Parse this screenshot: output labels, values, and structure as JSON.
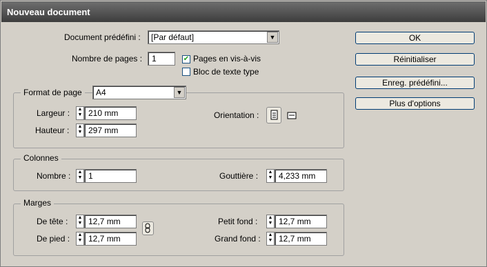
{
  "title": "Nouveau document",
  "preset": {
    "label": "Document prédéfini :",
    "value": "[Par défaut]"
  },
  "pages": {
    "label": "Nombre de pages :",
    "value": "1"
  },
  "facing_pages": {
    "label": "Pages en vis-à-vis",
    "checked": true
  },
  "master_text": {
    "label": "Bloc de texte type",
    "checked": false
  },
  "page_size": {
    "title": "Format de page",
    "value": "A4",
    "width_label": "Largeur :",
    "width_value": "210 mm",
    "height_label": "Hauteur :",
    "height_value": "297 mm",
    "orientation_label": "Orientation :"
  },
  "columns": {
    "title": "Colonnes",
    "number_label": "Nombre :",
    "number_value": "1",
    "gutter_label": "Gouttière :",
    "gutter_value": "4,233 mm"
  },
  "margins": {
    "title": "Marges",
    "top_label": "De tête :",
    "top_value": "12,7 mm",
    "bottom_label": "De pied :",
    "bottom_value": "12,7 mm",
    "inside_label": "Petit fond :",
    "inside_value": "12,7 mm",
    "outside_label": "Grand fond :",
    "outside_value": "12,7 mm"
  },
  "buttons": {
    "ok": "OK",
    "reset": "Réinitialiser",
    "save_preset": "Enreg. prédéfini...",
    "more_options": "Plus d'options"
  },
  "colors": {
    "titlebar": "#4a4a4a",
    "dialog_bg": "#d4d0c8",
    "checkmark": "#21a121"
  }
}
